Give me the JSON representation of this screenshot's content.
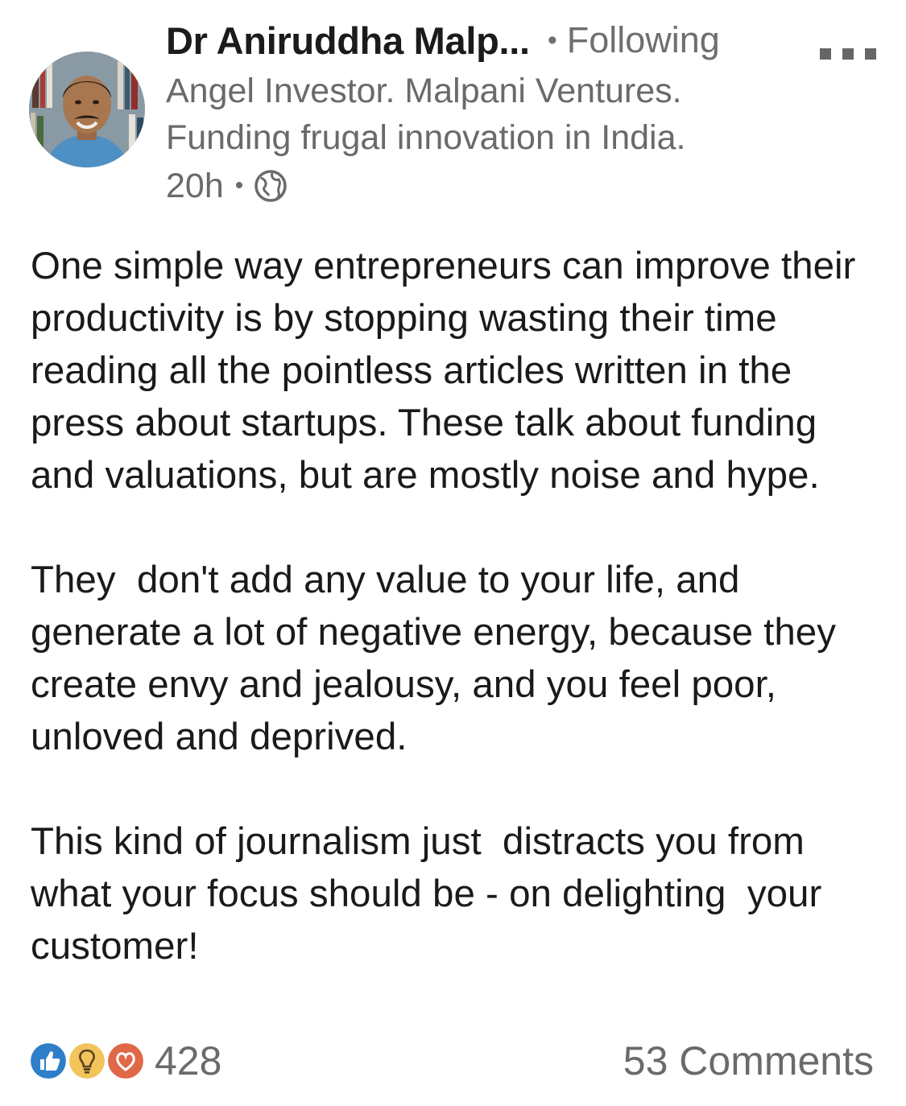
{
  "author": {
    "name": "Dr Aniruddha Malp...",
    "follow_separator": "•",
    "follow_status": "Following",
    "headline_line1": "Angel Investor. Malpani Ventures.",
    "headline_line2": "Funding frugal innovation in India.",
    "time_ago": "20h",
    "meta_separator": "•",
    "visibility_icon": "globe-icon"
  },
  "menu": {
    "icon": "more-options-icon"
  },
  "post": {
    "paragraphs": [
      "One simple way entrepreneurs can improve their productivity is by stopping wasting their time reading all the pointless articles written in the press about startups. These talk about funding and valuations, but are mostly noise and hype.",
      "They  don't add any value to your life, and generate a lot of negative energy, because they create envy and jealousy, and you feel poor, unloved and deprived.",
      "This kind of journalism just  distracts you from what your focus should be - on delighting  your customer!"
    ]
  },
  "social": {
    "reaction_icons": [
      "like-icon",
      "insightful-icon",
      "love-icon"
    ],
    "reaction_colors": {
      "like": "#2f7fc8",
      "insightful": "#f2c45a",
      "love": "#e06847"
    },
    "reaction_count": "428",
    "comments_label": "53 Comments"
  }
}
